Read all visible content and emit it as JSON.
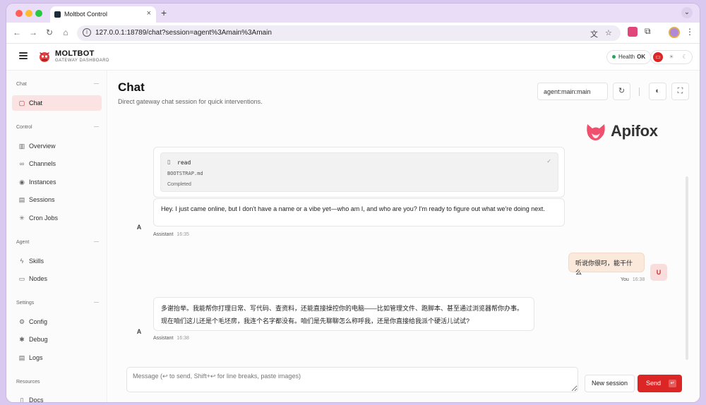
{
  "browser": {
    "tab_title": "Moltbot Control",
    "url": "127.0.0.1:18789/chat?session=agent%3Amain%3Amain"
  },
  "header": {
    "brand_name": "MOLTBOT",
    "brand_sub": "GATEWAY DASHBOARD",
    "health_label": "Health",
    "health_status": "OK"
  },
  "sidebar": {
    "groups": [
      {
        "title": "Chat",
        "items": [
          {
            "label": "Chat",
            "icon": "chat-bubble-icon",
            "active": true
          }
        ]
      },
      {
        "title": "Control",
        "items": [
          {
            "label": "Overview",
            "icon": "bar-chart-icon"
          },
          {
            "label": "Channels",
            "icon": "link-icon"
          },
          {
            "label": "Instances",
            "icon": "radio-icon"
          },
          {
            "label": "Sessions",
            "icon": "document-icon"
          },
          {
            "label": "Cron Jobs",
            "icon": "loader-icon"
          }
        ]
      },
      {
        "title": "Agent",
        "items": [
          {
            "label": "Skills",
            "icon": "lightning-icon"
          },
          {
            "label": "Nodes",
            "icon": "monitor-icon"
          }
        ]
      },
      {
        "title": "Settings",
        "items": [
          {
            "label": "Config",
            "icon": "gear-icon"
          },
          {
            "label": "Debug",
            "icon": "bug-icon"
          },
          {
            "label": "Logs",
            "icon": "file-text-icon"
          }
        ]
      },
      {
        "title": "Resources",
        "items": [
          {
            "label": "Docs",
            "icon": "book-icon"
          }
        ]
      }
    ]
  },
  "main": {
    "title": "Chat",
    "subtitle": "Direct gateway chat session for quick interventions.",
    "session_value": "agent:main:main",
    "watermark": "Apifox"
  },
  "messages": {
    "tool_card": {
      "name": "read",
      "path": "BOOTSTRAP.md",
      "status": "Completed"
    },
    "assistant_1": {
      "avatar": "A",
      "text": "Hey. I just came online, but I don't have a name or a vibe yet—who am I, and who are you? I'm ready to figure out what we're doing next.",
      "sender": "Assistant",
      "time": "16:35"
    },
    "user_1": {
      "avatar": "U",
      "text": "听说你很叼，能干什么",
      "sender": "You",
      "time": "16:38"
    },
    "assistant_2": {
      "avatar": "A",
      "line1": "多谢抬举。我能帮你打理日常、写代码、查资料，还能直接操控你的电脑——比如管理文件、跑脚本、甚至通过浏览器帮你办事。",
      "line2": "现在咱们这儿还是个毛坯房，我连个名字都没有。咱们是先聊聊怎么称呼我，还是你直接给我派个硬活儿试试?",
      "sender": "Assistant",
      "time": "16:38"
    }
  },
  "composer": {
    "placeholder": "Message (↩ to send, Shift+↩ for line breaks, paste images)",
    "new_session_label": "New session",
    "send_label": "Send",
    "send_key": "↵"
  },
  "colors": {
    "accent": "#dc2626",
    "active_bg": "#fbe3e3",
    "user_bubble": "#fbe9dc",
    "health_ok": "#22a55a"
  }
}
